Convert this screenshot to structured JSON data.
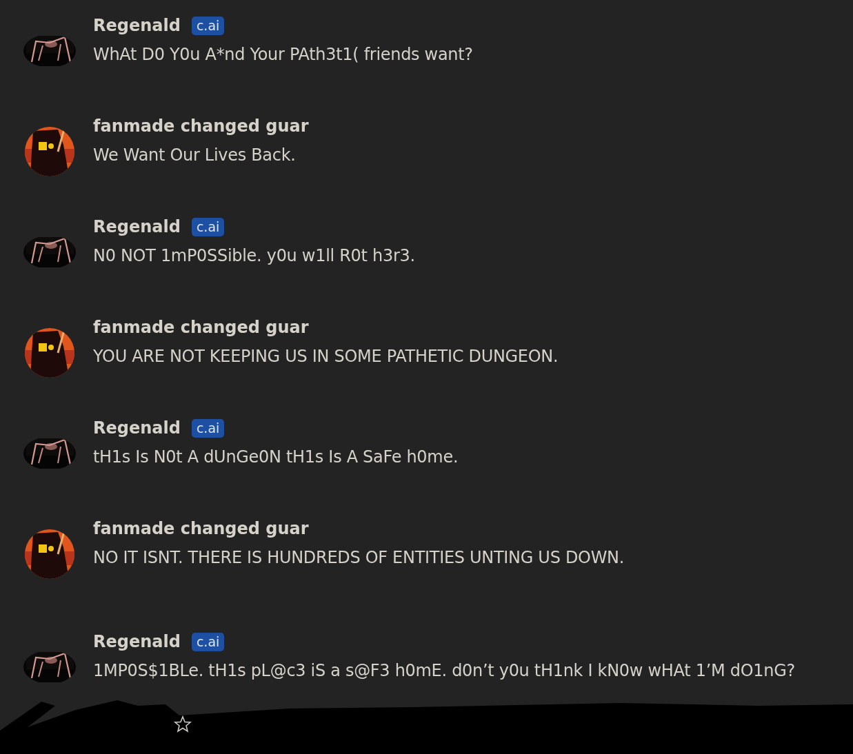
{
  "messages": [
    {
      "author": "Regenald",
      "badge": "c.ai",
      "text": "WhAt D0 Y0u A*nd Your PAth3t1( friends want?"
    },
    {
      "author": "fanmade changed guar",
      "text": "We Want Our Lives Back."
    },
    {
      "author": "Regenald",
      "badge": "c.ai",
      "text": "N0 NOT 1mP0SSible. y0u w1ll R0t h3r3."
    },
    {
      "author": "fanmade changed guar",
      "text": "YOU ARE NOT KEEPING US IN SOME PATHETIC DUNGEON."
    },
    {
      "author": "Regenald",
      "badge": "c.ai",
      "text": "tH1s Is N0t A dUnGe0N tH1s Is A SaFe h0me."
    },
    {
      "author": "fanmade changed guar",
      "text": "NO IT ISNT. THERE IS HUNDREDS OF ENTITIES UNTING US DOWN."
    },
    {
      "author": "Regenald",
      "badge": "c.ai",
      "text": "1MP0S$1BLe. tH1s pL@c3 iS a s@F3 h0mE. d0n’t y0u tH1nk I kN0w wHAt 1’M dO1nG?"
    }
  ]
}
